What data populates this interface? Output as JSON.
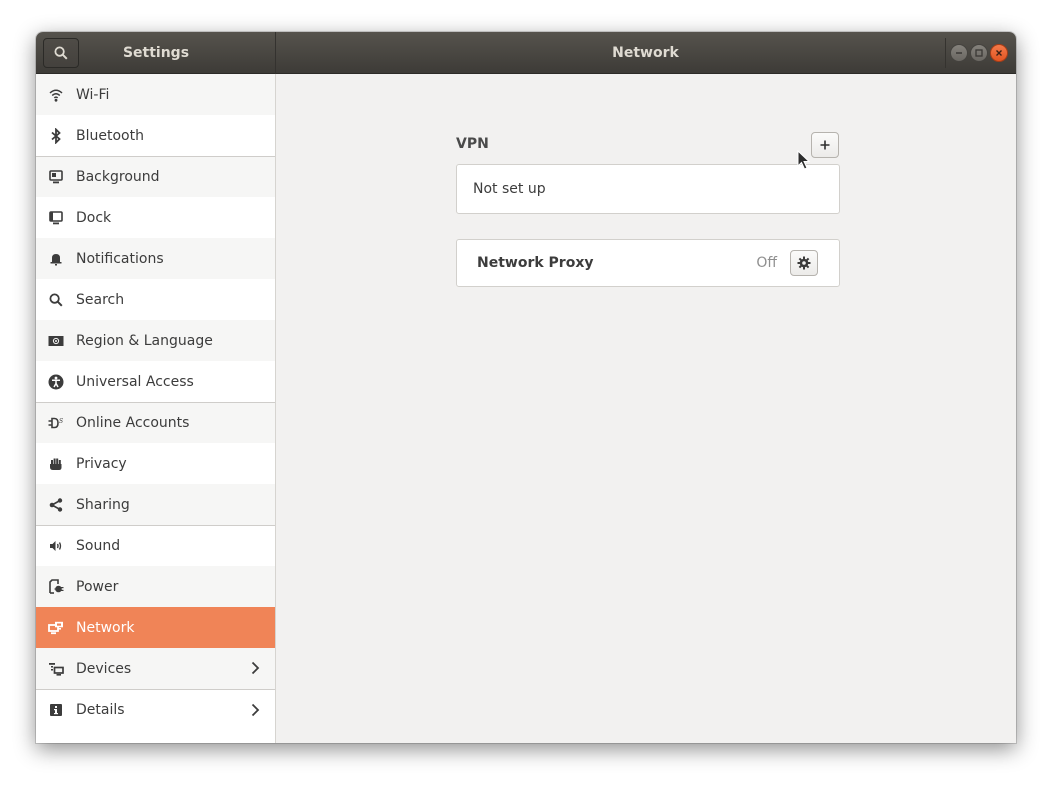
{
  "window": {
    "sidebar_title": "Settings",
    "page_title": "Network",
    "controls": [
      "minimize",
      "maximize",
      "close"
    ]
  },
  "sidebar": {
    "items": [
      {
        "label": "Wi-Fi",
        "icon": "wifi-icon"
      },
      {
        "label": "Bluetooth",
        "icon": "bluetooth-icon"
      },
      {
        "label": "Background",
        "icon": "background-icon"
      },
      {
        "label": "Dock",
        "icon": "dock-icon"
      },
      {
        "label": "Notifications",
        "icon": "bell-icon"
      },
      {
        "label": "Search",
        "icon": "search-icon"
      },
      {
        "label": "Region & Language",
        "icon": "flag-icon"
      },
      {
        "label": "Universal Access",
        "icon": "accessibility-icon"
      },
      {
        "label": "Online Accounts",
        "icon": "online-accounts-icon"
      },
      {
        "label": "Privacy",
        "icon": "hand-icon"
      },
      {
        "label": "Sharing",
        "icon": "share-icon"
      },
      {
        "label": "Sound",
        "icon": "speaker-icon"
      },
      {
        "label": "Power",
        "icon": "power-plug-icon"
      },
      {
        "label": "Network",
        "icon": "network-icon",
        "selected": true
      },
      {
        "label": "Devices",
        "icon": "devices-icon",
        "has_submenu": true
      },
      {
        "label": "Details",
        "icon": "info-icon",
        "has_submenu": true
      }
    ]
  },
  "main": {
    "vpn": {
      "title": "VPN",
      "add_button": "+",
      "status": "Not set up"
    },
    "proxy": {
      "label": "Network Proxy",
      "state": "Off"
    }
  },
  "colors": {
    "accent": "#f08457",
    "close_button": "#e9602f",
    "headerbar": "#46433f"
  }
}
